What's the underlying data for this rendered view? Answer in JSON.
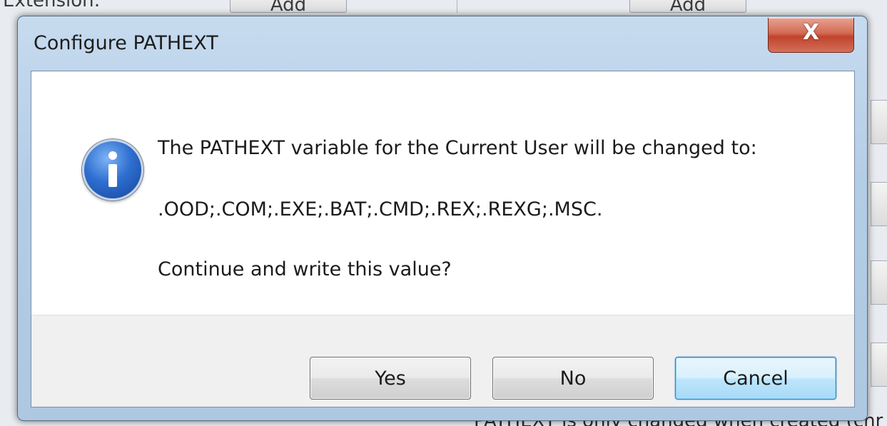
{
  "background": {
    "label_partial": "Extension:",
    "add_button_1": "Add",
    "add_button_2": "Add",
    "footer_text_partial": "PATHEXT is only changed when created (chr"
  },
  "dialog": {
    "title": "Configure PATHEXT",
    "close_glyph": "X",
    "icon": "information-icon",
    "message_line_1": "The PATHEXT variable for the Current User will be changed to:",
    "message_line_2": ".OOD;.COM;.EXE;.BAT;.CMD;.REX;.REXG;.MSC.",
    "message_line_3": "Continue and write this value?",
    "buttons": {
      "yes": "Yes",
      "no": "No",
      "cancel": "Cancel"
    },
    "default_button": "cancel"
  },
  "colors": {
    "titlebar": "#b4cde6",
    "close_button": "#c0432c",
    "info_icon": "#2f6fd0",
    "focused_button_border": "#3c7fb1"
  }
}
